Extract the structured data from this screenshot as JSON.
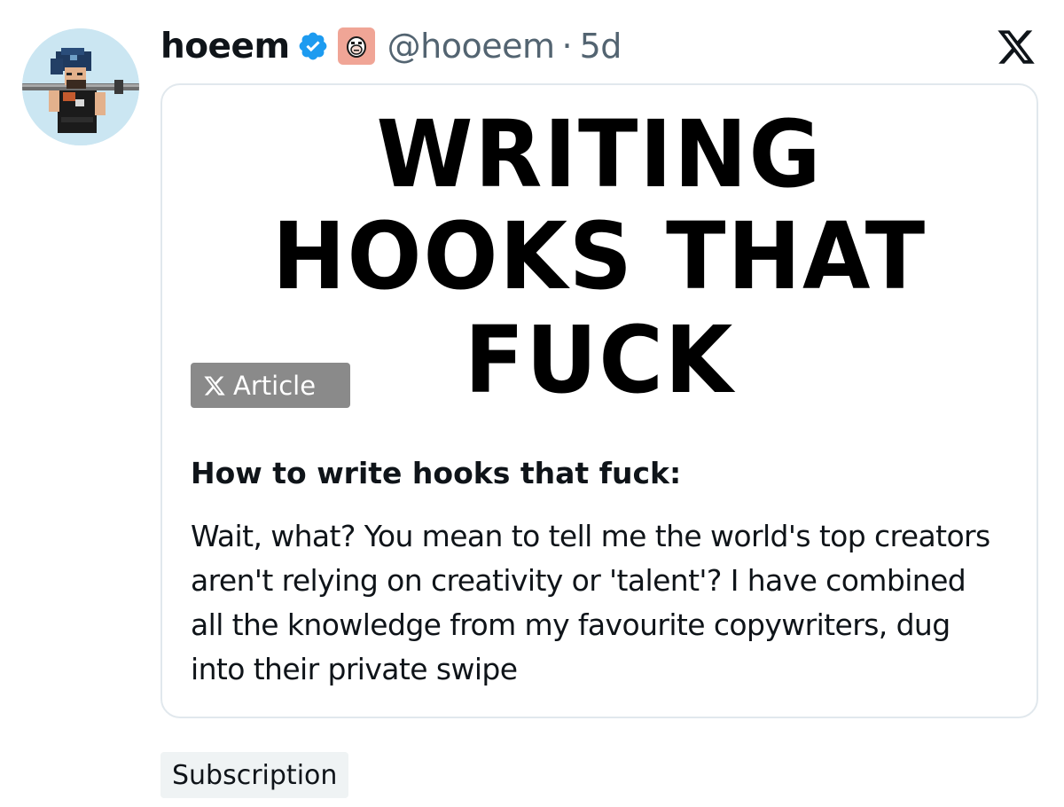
{
  "tweet": {
    "display_name": "hoeem",
    "handle": "@hooeem",
    "separator": "·",
    "time": "5d",
    "icons": {
      "verified": "verified-badge-icon",
      "affiliate": "affiliate-badge-icon",
      "platform": "x-logo-icon"
    },
    "colors": {
      "verified": "#1d9bf0",
      "affiliate_bg": "#f0a596",
      "muted_text": "#536471"
    }
  },
  "article": {
    "cover_lines": [
      "WRITING",
      "HOOKS THAT",
      "FUCK"
    ],
    "badge_label": "Article",
    "title": "How to write hooks that fuck:",
    "excerpt": "Wait, what? You mean to tell me the world's top creators aren't relying on creativity or 'talent'? I have combined all the knowledge from my favourite copywriters, dug into their private swipe"
  },
  "subscription_label": "Subscription"
}
